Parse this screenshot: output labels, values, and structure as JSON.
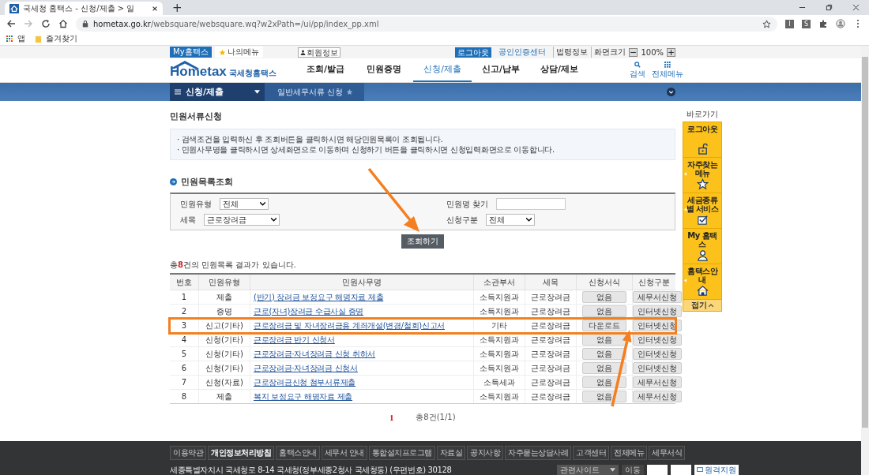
{
  "browser": {
    "tab_title": "국세청 홈택스 - 신청/제출 > 일",
    "new_tab": "+",
    "url_host": "hometax.go.kr",
    "url_path": "/websquare/websquare.wq?w2xPath=/ui/pp/index_pp.xml",
    "extensions": [
      "I",
      "S"
    ],
    "bookmarks": [
      {
        "label": "앱",
        "kind": "apps"
      },
      {
        "label": "즐겨찾기",
        "kind": "folder"
      }
    ]
  },
  "utility_bar": {
    "my_hometax": "My홈택스",
    "my_menu": "나의메뉴",
    "member_info": "회원정보",
    "logout": "로그아웃",
    "cert_center": "공인인증센터",
    "links": [
      "법령정보",
      "화면크기"
    ],
    "zoom": "100%"
  },
  "header": {
    "logo": "Hometax",
    "logo_name": "국세청홈택스",
    "nav": [
      {
        "label": "조회/발급",
        "selected": false
      },
      {
        "label": "민원증명",
        "selected": false
      },
      {
        "label": "신청/제출",
        "selected": true
      },
      {
        "label": "신고/납부",
        "selected": false
      },
      {
        "label": "상담/제보",
        "selected": false
      }
    ],
    "search": "검색",
    "all_menu": "전체메뉴"
  },
  "sub_nav": {
    "menu": "신청/제출",
    "breadcrumb": "일반세무서류 신청"
  },
  "page_title": "민원서류신청",
  "notes": [
    "· 검색조건을 입력하신 후 조회버튼을 클릭하시면 해당민원목록이 조회됩니다.",
    "· 민원사무명을 클릭하시면 상세화면으로 이동하며   신청하기 버튼을 클릭하시면 신청입력화면으로 이동합니다."
  ],
  "section_title": "민원목록조회",
  "filters": [
    {
      "label": "민원유형",
      "kind": "select",
      "value": "전체"
    },
    {
      "label": "민원명 찾기",
      "kind": "text"
    },
    {
      "label": "세목",
      "kind": "select",
      "value": "근로장려금"
    },
    {
      "label": "신청구분",
      "kind": "select",
      "value": "전체"
    }
  ],
  "search_button": "조회하기",
  "result_summary": "총**8**건의 민원목록 결과가 있습니다.",
  "table": {
    "columns": [
      "번호",
      "민원유형",
      "민원사무명",
      "소관부서",
      "세목",
      "신청서식",
      "신청구분"
    ],
    "rows": [
      {
        "no": "1",
        "type": "제출",
        "name": "(반기) 장려금 보정요구 해명자료 제출",
        "dept": "소득지원과",
        "tax": "근로장려금",
        "form": "없음",
        "apply": "세무서신청",
        "highlighted": false
      },
      {
        "no": "2",
        "type": "증명",
        "name": "근로(자녀)장려금 수급사실 증명",
        "dept": "소득지원과",
        "tax": "근로장려금",
        "form": "없음",
        "apply": "인터넷신청",
        "highlighted": false
      },
      {
        "no": "3",
        "type": "신고(기타)",
        "name": "근로장려금 및 자녀장려금용 계좌개설(변경/철회)신고서",
        "dept": "기타",
        "tax": "근로장려금",
        "form": "다운로드",
        "apply": "인터넷신청",
        "highlighted": true
      },
      {
        "no": "4",
        "type": "신청(기타)",
        "name": "근로장려금 반기 신청서",
        "dept": "소득지원과",
        "tax": "근로장려금",
        "form": "없음",
        "apply": "인터넷신청",
        "highlighted": false
      },
      {
        "no": "5",
        "type": "신청(기타)",
        "name": "근로장려금·자녀장려금 신청 취하서",
        "dept": "소득지원과",
        "tax": "근로장려금",
        "form": "없음",
        "apply": "인터넷신청",
        "highlighted": false
      },
      {
        "no": "6",
        "type": "신청(기타)",
        "name": "근로장려금·자녀장려금 신청서",
        "dept": "소득지원과",
        "tax": "근로장려금",
        "form": "없음",
        "apply": "인터넷신청",
        "highlighted": false
      },
      {
        "no": "7",
        "type": "신청(자료)",
        "name": "근로장려금신청 첨부서류제출",
        "dept": "소득세과",
        "tax": "근로장려금",
        "form": "없음",
        "apply": "세무서신청",
        "highlighted": false
      },
      {
        "no": "8",
        "type": "제출",
        "name": "복지 보정요구 해명자료 제출",
        "dept": "소득지원과",
        "tax": "근로장려금",
        "form": "없음",
        "apply": "세무서신청",
        "highlighted": false
      }
    ]
  },
  "pagination": {
    "pages": [
      {
        "label": "1",
        "selected": true
      }
    ],
    "total": "총8건(1/1)"
  },
  "quick_menu": {
    "title": "바로가기",
    "items": [
      {
        "label": "로그아웃",
        "kind": "lock",
        "has_submenu": false
      },
      {
        "label": "자주찾는 메뉴",
        "kind": "star",
        "has_submenu": true
      },
      {
        "label": "세금종류별 서비스",
        "kind": "check",
        "has_submenu": true
      },
      {
        "label": "My 홈택스",
        "kind": "person",
        "has_submenu": false
      },
      {
        "label": "홈택스안내",
        "kind": "house",
        "has_submenu": true
      }
    ],
    "close": "접기"
  },
  "footer": {
    "links": [
      {
        "label": "이용약관",
        "emphasized": false
      },
      {
        "label": "개인정보처리방침",
        "emphasized": true
      },
      {
        "label": "홈택스안내",
        "emphasized": false
      },
      {
        "label": "세무서 안내",
        "emphasized": false
      },
      {
        "label": "통합설치프로그램",
        "emphasized": false
      },
      {
        "label": "자료실",
        "emphasized": false
      },
      {
        "label": "공지사항",
        "emphasized": false
      },
      {
        "label": "자주묻는상담사례",
        "emphasized": false
      },
      {
        "label": "고객센터",
        "emphasized": false
      },
      {
        "label": "전체메뉴",
        "emphasized": false
      },
      {
        "label": "세무서식",
        "emphasized": false
      }
    ],
    "address": "세종특별자치시 국세청로 8-14 국세청(정부세종2청사 국세청동) (우편번호) 30128",
    "related_sites": "관련사이트",
    "go": "이동",
    "remote": "원격지원"
  }
}
